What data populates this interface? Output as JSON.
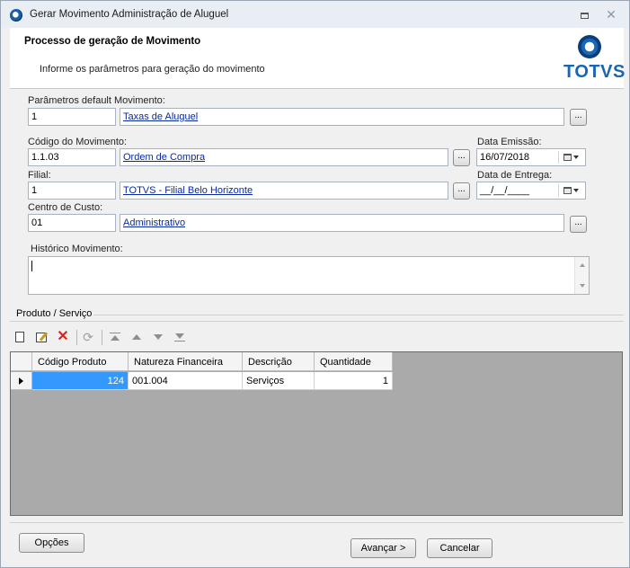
{
  "window": {
    "title": "Gerar Movimento Administração de Aluguel"
  },
  "header": {
    "title": "Processo de geração de Movimento",
    "subtitle": "Informe os parâmetros para geração do movimento",
    "logo_text": "TOTVS"
  },
  "form": {
    "parametros": {
      "label": "Parâmetros default Movimento:",
      "code": "1",
      "desc": "Taxas de Aluguel"
    },
    "codigo_movimento": {
      "label": "Código do Movimento:",
      "code": "1.1.03",
      "desc": "Ordem de Compra"
    },
    "data_emissao": {
      "label": "Data Emissão:",
      "value": "16/07/2018"
    },
    "filial": {
      "label": "Filial:",
      "code": "1",
      "desc": "TOTVS - Filial Belo Horizonte"
    },
    "data_entrega": {
      "label": "Data de Entrega:",
      "value": "__/__/____"
    },
    "centro_custo": {
      "label": "Centro de Custo:",
      "code": "01",
      "desc": "Administrativo"
    },
    "historico": {
      "label": "Histórico Movimento:",
      "value": ""
    },
    "browse_label": "..."
  },
  "produtos": {
    "group_label": "Produto / Serviço",
    "columns": [
      "Código Produto",
      "Natureza Financeira",
      "Descrição",
      "Quantidade"
    ],
    "rows": [
      {
        "codigo": "124",
        "natureza": "001.004",
        "descricao": "Serviços",
        "quantidade": "1"
      }
    ]
  },
  "toolbar_icons": [
    "new-icon",
    "edit-icon",
    "delete-icon",
    "refresh-icon",
    "move-first-icon",
    "move-up-icon",
    "move-down-icon",
    "move-last-icon"
  ],
  "buttons": {
    "opcoes": "Opções",
    "avancar": "Avançar >",
    "cancelar": "Cancelar"
  },
  "colors": {
    "accent": "#1a66b2",
    "selection": "#3399ff",
    "link": "#0a2aa0",
    "delete": "#d8261b"
  }
}
